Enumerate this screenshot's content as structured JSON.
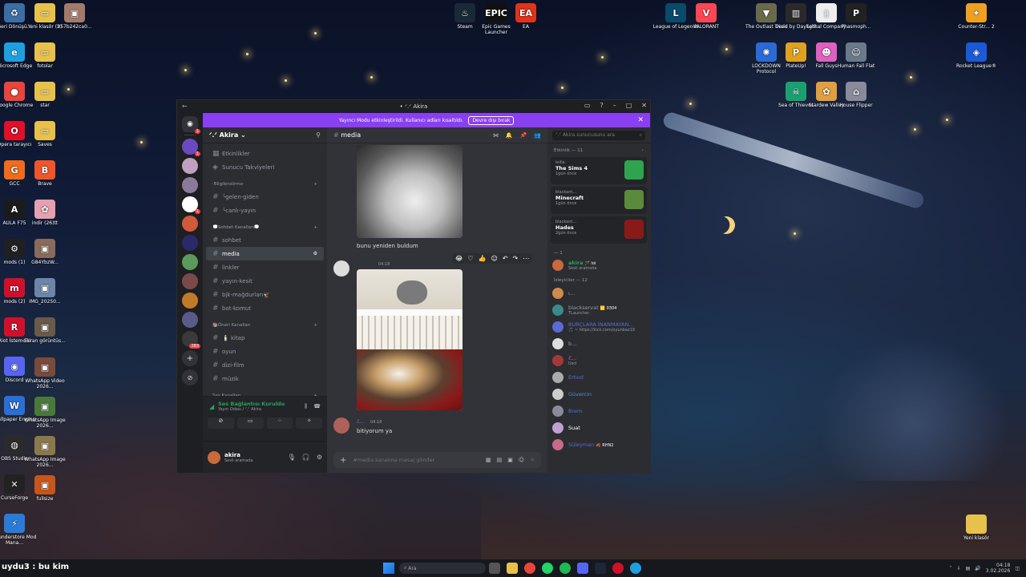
{
  "desktop_left": [
    {
      "label": "Geri Dönüşü...",
      "color": "#3a6ea5",
      "glyph": "♻",
      "icon": "recycle-bin-icon"
    },
    {
      "label": "Microsoft Edge",
      "color": "#1ea0e0",
      "glyph": "e",
      "icon": "edge-icon"
    },
    {
      "label": "Google Chrome",
      "color": "#e8453c",
      "glyph": "●",
      "icon": "chrome-icon"
    },
    {
      "label": "Opera tarayıcı",
      "color": "#e0102a",
      "glyph": "O",
      "icon": "opera-icon"
    },
    {
      "label": "GCC",
      "color": "#f26a1b",
      "glyph": "G",
      "icon": "gcc-icon"
    },
    {
      "label": "AULA F75",
      "color": "#1b1b1b",
      "glyph": "A",
      "icon": "aula-icon"
    },
    {
      "label": "mods (1)",
      "color": "#202020",
      "glyph": "⚙",
      "icon": "mods-icon"
    },
    {
      "label": "mods (2)",
      "color": "#d0102a",
      "glyph": "m",
      "icon": "mods2-icon"
    },
    {
      "label": "Riot İstemcisi",
      "color": "#d0102a",
      "glyph": "R",
      "icon": "riot-icon"
    },
    {
      "label": "Discord",
      "color": "#5865f2",
      "glyph": "◉",
      "icon": "discord-icon"
    },
    {
      "label": "Wallpaper Engine",
      "color": "#2a6fd6",
      "glyph": "W",
      "icon": "wallpaper-engine-icon"
    },
    {
      "label": "OBS Studio",
      "color": "#2b2b2b",
      "glyph": "◍",
      "icon": "obs-icon"
    },
    {
      "label": "CurseForge",
      "color": "#222",
      "glyph": "✕",
      "icon": "curseforge-icon"
    },
    {
      "label": "Thunderstore Mod Mana...",
      "color": "#2a7bd6",
      "glyph": "⚡",
      "icon": "thunderstore-icon"
    }
  ],
  "desktop_col2": [
    {
      "label": "Yeni klasör (2)",
      "color": "#e8c14a",
      "glyph": "▭",
      "icon": "folder-icon"
    },
    {
      "label": "fotolar",
      "color": "#e8c14a",
      "glyph": "▭",
      "icon": "folder-icon"
    },
    {
      "label": "star",
      "color": "#e8c14a",
      "glyph": "▭",
      "icon": "folder-icon"
    },
    {
      "label": "Saves",
      "color": "#e8c14a",
      "glyph": "▭",
      "icon": "folder-icon"
    },
    {
      "label": "Brave",
      "color": "#f0552a",
      "glyph": "B",
      "icon": "brave-icon"
    },
    {
      "label": "indir (26)tt",
      "color": "#e6a0b0",
      "glyph": "✿",
      "icon": "image-icon"
    },
    {
      "label": "G84YbzW...",
      "color": "#8a6b5a",
      "glyph": "▣",
      "icon": "image-icon"
    },
    {
      "label": "IMG_20250...",
      "color": "#6b86a8",
      "glyph": "▣",
      "icon": "image-icon"
    },
    {
      "label": "Ekran görüntüs...",
      "color": "#6a5a4a",
      "glyph": "▣",
      "icon": "image-icon"
    },
    {
      "label": "WhatsApp Video 2026...",
      "color": "#7a4a3a",
      "glyph": "▣",
      "icon": "video-icon"
    },
    {
      "label": "WhatsApp Image 2026...",
      "color": "#4a7a3a",
      "glyph": "▣",
      "icon": "image-icon"
    },
    {
      "label": "WhatsApp Image 2026...",
      "color": "#8a7a4a",
      "glyph": "▣",
      "icon": "image-icon"
    },
    {
      "label": "fullsize",
      "color": "#c8551a",
      "glyph": "▣",
      "icon": "image-icon"
    }
  ],
  "desktop_col3": [
    {
      "label": "957b242ca0...",
      "color": "#a47a6a",
      "glyph": "▣",
      "icon": "image-icon"
    }
  ],
  "desktop_top": [
    {
      "label": "Steam",
      "color": "#1b2838",
      "glyph": "♨",
      "icon": "steam-icon"
    },
    {
      "label": "Epic Games Launcher",
      "color": "#111",
      "glyph": "EPIC",
      "icon": "epic-icon"
    },
    {
      "label": "EA",
      "color": "#e0341a",
      "glyph": "EA",
      "icon": "ea-icon"
    },
    {
      "label": "League of Legends",
      "color": "#0a4a6a",
      "glyph": "L",
      "icon": "lol-icon"
    },
    {
      "label": "VALORANT",
      "color": "#ff4655",
      "glyph": "V",
      "icon": "valorant-icon"
    },
    {
      "label": "The Outlast Trials",
      "color": "#6a6a4a",
      "glyph": "▼",
      "icon": "outlast-icon"
    },
    {
      "label": "Dead by Daylight",
      "color": "#2a2a2a",
      "glyph": "▥",
      "icon": "dbd-icon"
    },
    {
      "label": "Lethal Company",
      "color": "#eee",
      "glyph": "▯",
      "icon": "lethal-icon"
    },
    {
      "label": "Phasmoph...",
      "color": "#222",
      "glyph": "P",
      "icon": "phasmophobia-icon"
    },
    {
      "label": "Counter-Str... 2",
      "color": "#f0a020",
      "glyph": "✦",
      "icon": "cs2-icon"
    }
  ],
  "desktop_row2": [
    {
      "label": "LOCKDOWN Protocol",
      "color": "#2a6ad6",
      "glyph": "✺",
      "icon": "lockdown-icon"
    },
    {
      "label": "PlateUp!",
      "color": "#e0a020",
      "glyph": "P",
      "icon": "plateup-icon"
    },
    {
      "label": "Fall Guys",
      "color": "#e060c0",
      "glyph": "☻",
      "icon": "fallguys-icon"
    },
    {
      "label": "Human Fall Flat",
      "color": "#6a7a8a",
      "glyph": "☺",
      "icon": "hff-icon"
    },
    {
      "label": "Rocket League®",
      "color": "#1a5ad6",
      "glyph": "◈",
      "icon": "rocket-league-icon"
    }
  ],
  "desktop_row3": [
    {
      "label": "Sea of Thieves",
      "color": "#1aa070",
      "glyph": "☠",
      "icon": "sot-icon"
    },
    {
      "label": "Stardew Valley",
      "color": "#e0a040",
      "glyph": "✿",
      "icon": "stardew-icon"
    },
    {
      "label": "House Flipper",
      "color": "#8a8a9a",
      "glyph": "⌂",
      "icon": "house-flipper-icon"
    }
  ],
  "desktop_bottom_right": {
    "label": "Yeni klasör"
  },
  "discord": {
    "window_title": "• ᐟ.ᐟ Akira",
    "banner": {
      "text": "Yayıncı Modu etkinleştirildi. Kullanıcı adları kısaltıldı.",
      "button": "Devre dışı bırak"
    },
    "server_name": "ᐟ.ᐟ Akira",
    "top_items": [
      "Etkinlikler",
      "Sunucu Takviyeleri"
    ],
    "categories": [
      {
        "name": "⋅Bilgilendirme⋅",
        "channels": [
          "╰gelen-giden",
          "╰canlı-yayın"
        ]
      },
      {
        "name": "💭Sohbet Kanalları💭",
        "channels": [
          "sohbet",
          "media",
          "linkler",
          "yayın-kesit",
          "bjk-mağdurları🦅",
          "bot-komut"
        ]
      },
      {
        "name": "📚Öneri Kanalları",
        "channels": [
          "🕯️ kitap",
          "oyun",
          "dizi-film",
          "müzik"
        ]
      },
      {
        "name": "Ses Kanalları",
        "channels": []
      }
    ],
    "active_channel": "media",
    "voice": {
      "status": "Ses Bağlantısı Kuruldu",
      "sub": "Yayın Odası / ᐟ.ᐟ Akira"
    },
    "user": {
      "name": "akira",
      "status": "Sesli aramada"
    },
    "chat": {
      "channel": "media",
      "msg1": "bunu yeniden buldum",
      "msg2_time": "04:18",
      "msg3_time": "04:18",
      "msg3_name": "ℰ...",
      "msg3": "bitiyorum ya",
      "composer_placeholder": "#media kanalına mesaj gönder"
    },
    "search_placeholder": "ᐟ.ᐟ Akira sunucusunu ara",
    "activity_header": "Etkinlik — 11",
    "activities": [
      {
        "user": "leilia",
        "game": "The Sims 4",
        "meta": "1gün önce",
        "color": "#2ea44f"
      },
      {
        "user": "blackant...",
        "game": "Minecraft",
        "meta": "1gün önce",
        "color": "#5a8a3a"
      },
      {
        "user": "blackant...",
        "game": "Hades",
        "meta": "2gün önce",
        "color": "#8a1a1a"
      }
    ],
    "group1": "— 1",
    "member_akira": {
      "name": "akira",
      "tag": "🪄 loi",
      "status": "Sesli aramada"
    },
    "group2": "İzleyiciler — 12",
    "members": [
      {
        "name": "ι...",
        "status": "",
        "color": "#d08a4a",
        "namecolor": "#949ba4"
      },
      {
        "name": "blackservat",
        "tag": "🟨 0304",
        "status": "TLauncher",
        "color": "#3a8a8a",
        "namecolor": "#949ba4"
      },
      {
        "name": "BURÇLARA İNANMAYAN...",
        "status": "🎵 ~ https://kick.com/oyunbaz19",
        "color": "#5a6ad6",
        "namecolor": "#5a6ad6"
      },
      {
        "name": "b...",
        "status": "",
        "color": "#ddd",
        "namecolor": "#949ba4"
      },
      {
        "name": "ℰ...",
        "status": "Uscl",
        "color": "#a03a3a",
        "namecolor": "#d06ad0"
      },
      {
        "name": "Erhod",
        "status": "",
        "color": "#aaa",
        "namecolor": "#5a6ad6"
      },
      {
        "name": "Güvercin",
        "status": "",
        "color": "#ccc",
        "namecolor": "#5a8ad6"
      },
      {
        "name": "Brem",
        "status": "",
        "color": "#8a8a9a",
        "namecolor": "#5a6ad6"
      },
      {
        "name": "Suat",
        "status": "",
        "color": "#c0a0d0",
        "namecolor": "#ffffff"
      },
      {
        "name": "Süleyman",
        "tag": "🍂 RHN2",
        "status": "",
        "color": "#c86a8a",
        "namecolor": "#5a6ad6"
      }
    ]
  },
  "taskbar": {
    "search": "Ara",
    "time": "04:18",
    "date": "3.02.2026",
    "overlay": "uydu3 : bu kim"
  }
}
